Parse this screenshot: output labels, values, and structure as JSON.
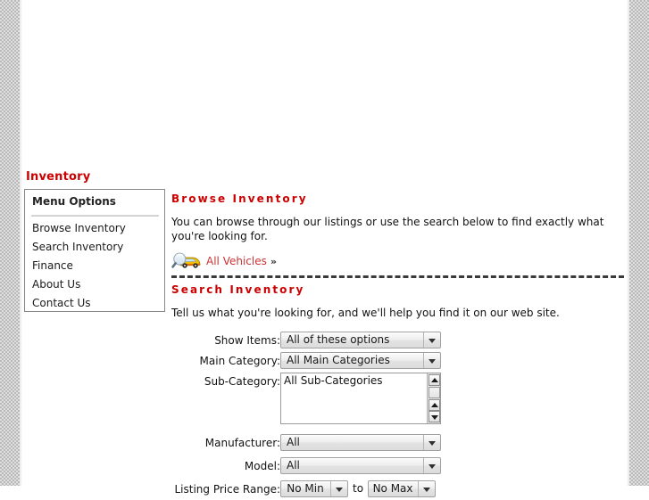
{
  "page": {
    "title": "Inventory"
  },
  "sidebar": {
    "heading": "Menu Options",
    "items": [
      {
        "label": "Browse Inventory"
      },
      {
        "label": "Search Inventory"
      },
      {
        "label": "Finance"
      },
      {
        "label": "About Us"
      },
      {
        "label": "Contact Us"
      }
    ]
  },
  "main": {
    "browse": {
      "title": "Browse Inventory",
      "description": "You can browse through our listings or use the search below to find exactly what you're looking for.",
      "link_label": "All Vehicles",
      "link_chevron": "»",
      "link_icon": "magnifier-car-icon"
    },
    "search": {
      "title": "Search Inventory",
      "description": "Tell us what you're looking for, and we'll help you find it on our web site."
    }
  },
  "form": {
    "rows": [
      {
        "name": "show-items",
        "label": "Show Items:",
        "control": "select",
        "value": "All of these options"
      },
      {
        "name": "main-category",
        "label": "Main Category:",
        "control": "select",
        "value": "All Main Categories"
      },
      {
        "name": "sub-category",
        "label": "Sub-Category:",
        "control": "listbox",
        "value": "All Sub-Categories"
      },
      {
        "name": "manufacturer",
        "label": "Manufacturer:",
        "control": "select",
        "value": "All"
      },
      {
        "name": "model",
        "label": "Model:",
        "control": "select",
        "value": "All"
      },
      {
        "name": "listing-price-range",
        "label": "Listing Price Range:",
        "control": "range",
        "min_value": "No Min",
        "max_value": "No Max",
        "separator": "to"
      }
    ]
  },
  "colors": {
    "heading_red": "#cc0000",
    "link_red": "#cc3333",
    "text": "#111111",
    "menu_border": "#888888",
    "edge_texture": "#b9b9b9"
  }
}
